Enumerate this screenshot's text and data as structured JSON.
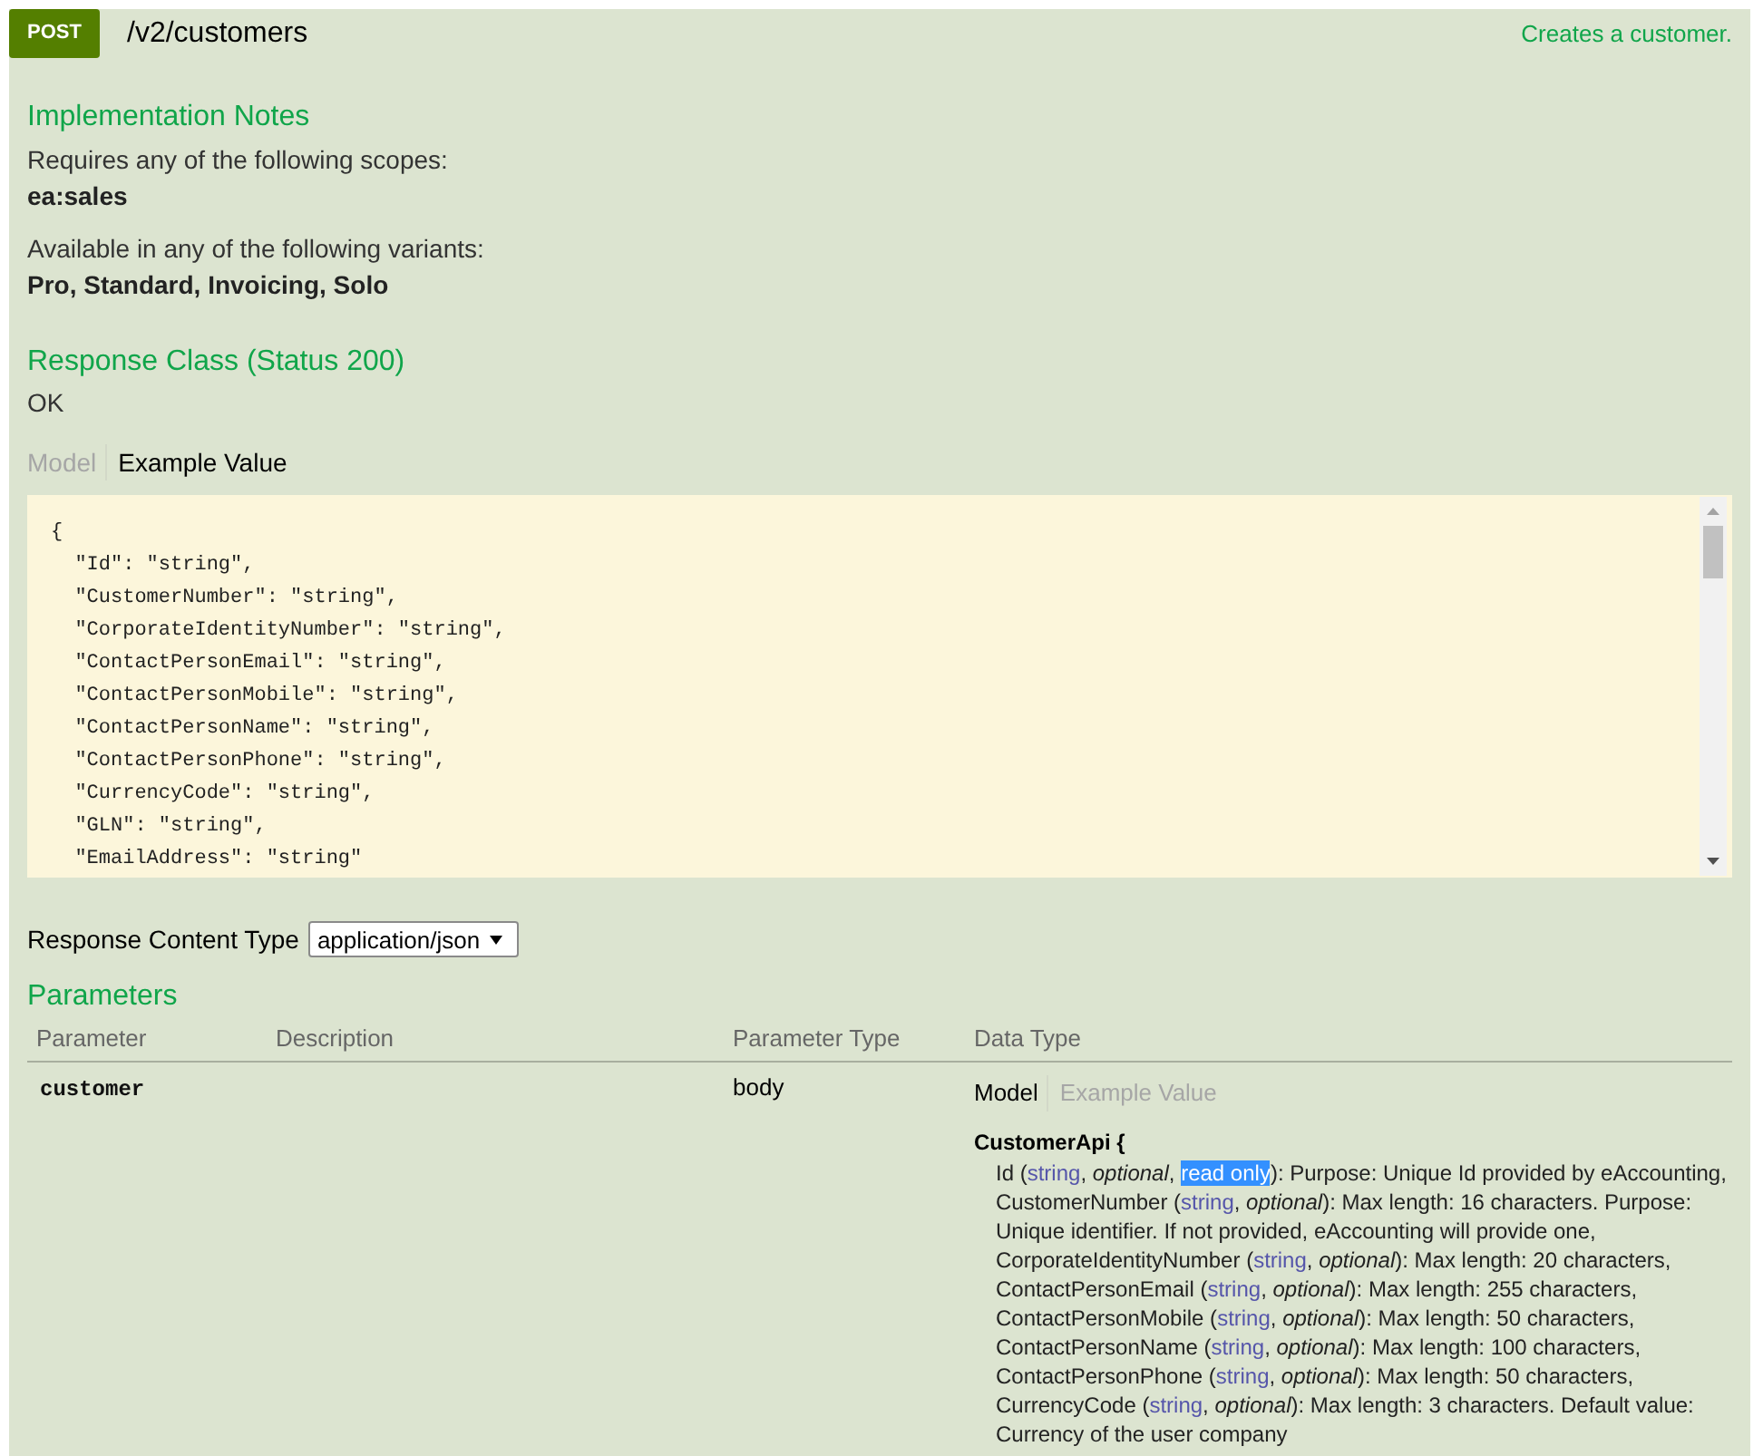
{
  "operation": {
    "method": "POST",
    "path": "/v2/customers",
    "summary": "Creates a customer."
  },
  "implementation_notes": {
    "title": "Implementation Notes",
    "paragraphs": [
      {
        "text": "Requires any of the following scopes:",
        "value": "ea:sales"
      },
      {
        "text": "Available in any of the following variants:",
        "value": "Pro, Standard, Invoicing, Solo"
      }
    ]
  },
  "response_class": {
    "title": "Response Class (Status 200)",
    "status": "OK",
    "tabs": [
      {
        "label": "Model",
        "selected": false
      },
      {
        "label": "Example Value",
        "selected": true
      }
    ],
    "example_lines": [
      "{",
      "  \"Id\": \"string\",",
      "  \"CustomerNumber\": \"string\",",
      "  \"CorporateIdentityNumber\": \"string\",",
      "  \"ContactPersonEmail\": \"string\",",
      "  \"ContactPersonMobile\": \"string\",",
      "  \"ContactPersonName\": \"string\",",
      "  \"ContactPersonPhone\": \"string\",",
      "  \"CurrencyCode\": \"string\",",
      "  \"GLN\": \"string\",",
      "  \"EmailAddress\": \"string\""
    ]
  },
  "response_content_type": {
    "label": "Response Content Type",
    "value": "application/json"
  },
  "parameters": {
    "title": "Parameters",
    "columns": [
      "Parameter",
      "Description",
      "Parameter Type",
      "Data Type"
    ],
    "rows": [
      {
        "parameter": "customer",
        "parameter_type": "body",
        "data_type": {
          "tabs": [
            {
              "label": "Model",
              "selected": true
            },
            {
              "label": "Example Value",
              "selected": false
            }
          ],
          "model": {
            "title": "CustomerApi {",
            "properties": [
              {
                "parts": [
                  {
                    "kind": "text",
                    "text": "Id (",
                    "highlighted": false
                  },
                  {
                    "kind": "type",
                    "text": "string",
                    "highlighted": false
                  },
                  {
                    "kind": "text",
                    "text": ", *optional*, ",
                    "highlighted": false
                  },
                  {
                    "kind": "text",
                    "text": "read only",
                    "highlighted": true
                  },
                  {
                    "kind": "text",
                    "text": "): Purpose: Unique Id provided by eAccounting,",
                    "highlighted": false
                  }
                ]
              },
              {
                "parts": [
                  {
                    "kind": "text",
                    "text": "CustomerNumber (",
                    "highlighted": false
                  },
                  {
                    "kind": "type",
                    "text": "string",
                    "highlighted": false
                  },
                  {
                    "kind": "text",
                    "text": ", *optional*): Max length: 16 characters. Purpose: Unique identifier. If not provided, eAccounting will provide one,",
                    "highlighted": false
                  }
                ]
              },
              {
                "parts": [
                  {
                    "kind": "text",
                    "text": "CorporateIdentityNumber (",
                    "highlighted": false
                  },
                  {
                    "kind": "type",
                    "text": "string",
                    "highlighted": false
                  },
                  {
                    "kind": "text",
                    "text": ", *optional*): Max length: 20 characters,",
                    "highlighted": false
                  }
                ]
              },
              {
                "parts": [
                  {
                    "kind": "text",
                    "text": "ContactPersonEmail (",
                    "highlighted": false
                  },
                  {
                    "kind": "type",
                    "text": "string",
                    "highlighted": false
                  },
                  {
                    "kind": "text",
                    "text": ", *optional*): Max length: 255 characters,",
                    "highlighted": false
                  }
                ]
              },
              {
                "parts": [
                  {
                    "kind": "text",
                    "text": "ContactPersonMobile (",
                    "highlighted": false
                  },
                  {
                    "kind": "type",
                    "text": "string",
                    "highlighted": false
                  },
                  {
                    "kind": "text",
                    "text": ", *optional*): Max length: 50 characters,",
                    "highlighted": false
                  }
                ]
              },
              {
                "parts": [
                  {
                    "kind": "text",
                    "text": "ContactPersonName (",
                    "highlighted": false
                  },
                  {
                    "kind": "type",
                    "text": "string",
                    "highlighted": false
                  },
                  {
                    "kind": "text",
                    "text": ", *optional*): Max length: 100 characters,",
                    "highlighted": false
                  }
                ]
              },
              {
                "parts": [
                  {
                    "kind": "text",
                    "text": "ContactPersonPhone (",
                    "highlighted": false
                  },
                  {
                    "kind": "type",
                    "text": "string",
                    "highlighted": false
                  },
                  {
                    "kind": "text",
                    "text": ", *optional*): Max length: 50 characters,",
                    "highlighted": false
                  }
                ]
              },
              {
                "parts": [
                  {
                    "kind": "text",
                    "text": "CurrencyCode (",
                    "highlighted": false
                  },
                  {
                    "kind": "type",
                    "text": "string",
                    "highlighted": false
                  },
                  {
                    "kind": "text",
                    "text": ", *optional*): Max length: 3 characters. Default value: Currency of the user company",
                    "highlighted": false
                  }
                ]
              }
            ]
          }
        }
      }
    ]
  }
}
